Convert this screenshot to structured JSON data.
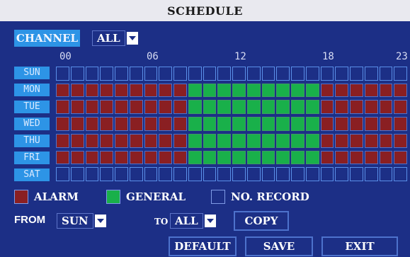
{
  "title": "SCHEDULE",
  "channel": {
    "label": "CHANNEL",
    "selected": "ALL"
  },
  "hour_labels": [
    "00",
    "06",
    "12",
    "18",
    "23"
  ],
  "days": [
    "SUN",
    "MON",
    "TUE",
    "WED",
    "THU",
    "FRI",
    "SAT"
  ],
  "schedule": {
    "slots_per_day": 24,
    "SUN": "nnnnnnnnnnnnnnnnnnnnnnnn",
    "MON": "aaaaaaaaagggggggggaaaaaa",
    "TUE": "aaaaaaaaagggggggggaaaaaa",
    "WED": "aaaaaaaaagggggggggaaaaaa",
    "THU": "aaaaaaaaagggggggggaaaaaa",
    "FRI": "aaaaaaaaagggggggggaaaaaa",
    "SAT": "nnnnnnnnnnnnnnnnnnnnnnnn"
  },
  "legend": {
    "alarm": "ALARM",
    "general": "GENERAL",
    "none": "NO. RECORD"
  },
  "colors": {
    "alarm": "#8a1f22",
    "general": "#19b04a",
    "background": "#1c2f86",
    "label": "#2d94e6"
  },
  "copy_row": {
    "from_label": "FROM",
    "from_value": "SUN",
    "to_label": "TO",
    "to_value": "ALL",
    "copy_button": "COPY"
  },
  "buttons": {
    "default": "DEFAULT",
    "save": "SAVE",
    "exit": "EXIT"
  }
}
